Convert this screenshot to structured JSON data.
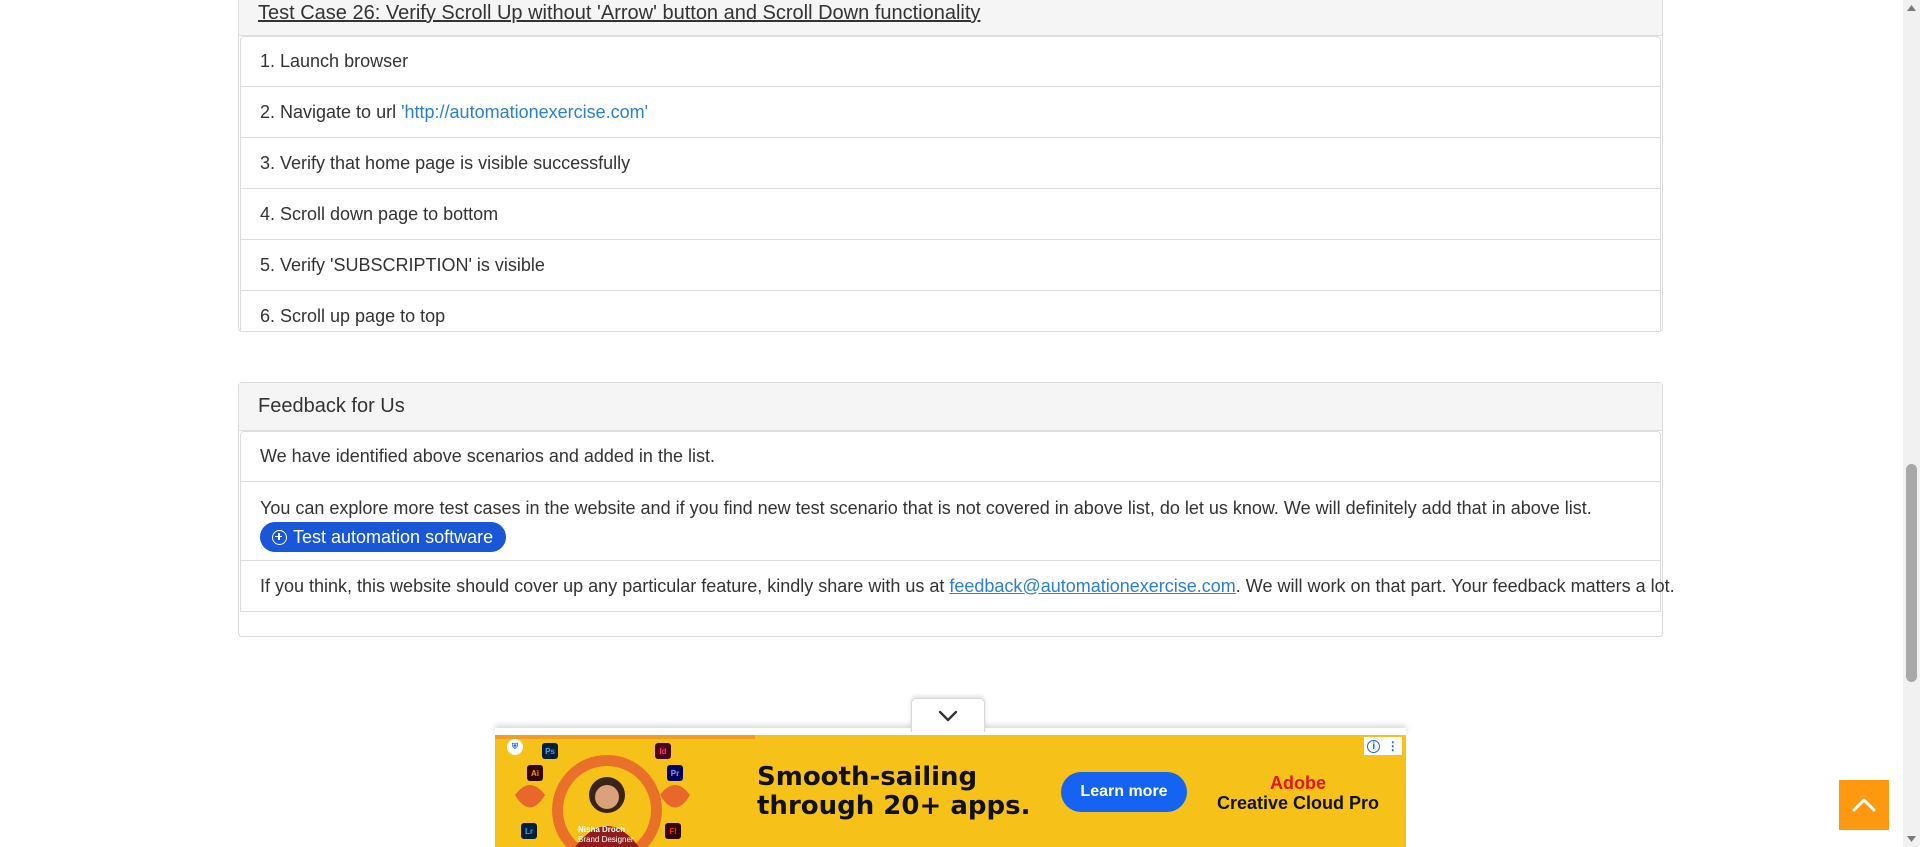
{
  "test_case": {
    "title": "Test Case 26: Verify Scroll Up without 'Arrow' button and Scroll Down functionality",
    "steps": [
      {
        "text": "1. Launch browser"
      },
      {
        "text": "2. Navigate to url",
        "link": "'http://automationexercise.com'"
      },
      {
        "text": "3. Verify that home page is visible successfully"
      },
      {
        "text": "4. Scroll down page to bottom"
      },
      {
        "text": "5. Verify 'SUBSCRIPTION' is visible"
      },
      {
        "text": "6. Scroll up page to top"
      }
    ]
  },
  "feedback": {
    "heading": "Feedback for Us",
    "line1": "We have identified above scenarios and added in the list.",
    "line2": "You can explore more test cases in the website and if you find new test scenario that is not covered in above list, do let us know. We will definitely add that in above list.",
    "button_label": "Test automation software",
    "line3_prefix": "If you think, this website should cover up any particular feature, kindly share with us at",
    "email": "feedback@automationexercise.com",
    "line3_suffix": ". We will work on that part. Your feedback matters a lot."
  },
  "ad": {
    "headline_1": "Smooth-sailing",
    "headline_2": "through 20+ apps.",
    "cta": "Learn more",
    "brand_1": "Adobe",
    "brand_2": "Creative Cloud Pro",
    "person_name": "Nisha Droch",
    "person_role": "Brand Designer",
    "app_tiles": [
      "Ps",
      "Id",
      "Ai",
      "Pr",
      "Lr",
      "Fl"
    ]
  },
  "colors": {
    "accent_link": "#2a7fd4",
    "button_blue": "#1a56d8",
    "scroll_top": "#fe980f",
    "ad_background": "#f6c21a"
  },
  "icons": {
    "scroll_top": "chevron-up-icon",
    "ad_toggle": "chevron-down-icon",
    "button": "plus-circle-icon"
  }
}
